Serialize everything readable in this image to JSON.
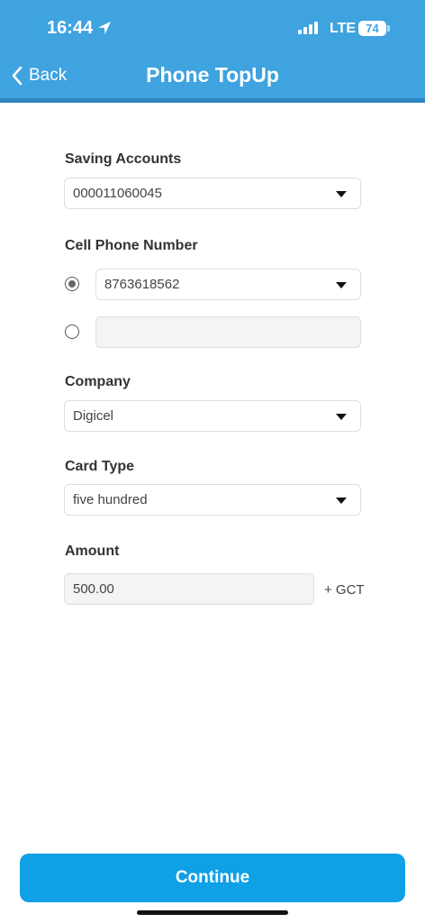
{
  "status_bar": {
    "time": "16:44",
    "network": "LTE",
    "battery": "74",
    "icons": [
      "location-arrow-icon",
      "signal-bars-icon",
      "battery-icon"
    ]
  },
  "header": {
    "back_label": "Back",
    "title": "Phone TopUp",
    "background_color": "#3fa3e0"
  },
  "form": {
    "saving_accounts": {
      "label": "Saving Accounts",
      "value": "000011060045"
    },
    "cell_phone": {
      "label": "Cell Phone Number",
      "options": [
        {
          "value": "8763618562",
          "selected": true
        },
        {
          "value": "",
          "selected": false
        }
      ]
    },
    "company": {
      "label": "Company",
      "value": "Digicel"
    },
    "card_type": {
      "label": "Card Type",
      "value": "five hundred"
    },
    "amount": {
      "label": "Amount",
      "value": "500.00",
      "suffix": "+ GCT"
    }
  },
  "continue_button": {
    "label": "Continue",
    "color": "#0fa0e6"
  }
}
